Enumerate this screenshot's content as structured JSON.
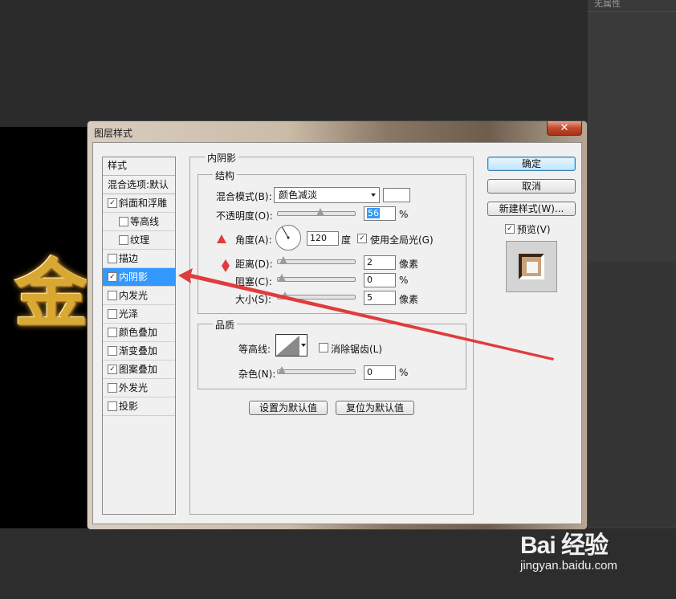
{
  "app": {
    "right_panel_tab": "无属性"
  },
  "canvas": {
    "text": "金"
  },
  "dialog": {
    "title": "图层样式",
    "close_glyph": "✕",
    "styles_header": "样式",
    "blend_options": "混合选项:默认",
    "styles": [
      {
        "label": "斜面和浮雕",
        "checked": true,
        "indent": false
      },
      {
        "label": "等高线",
        "checked": false,
        "indent": true
      },
      {
        "label": "纹理",
        "checked": false,
        "indent": true
      },
      {
        "label": "描边",
        "checked": false,
        "indent": false
      },
      {
        "label": "内阴影",
        "checked": true,
        "indent": false,
        "active": true
      },
      {
        "label": "内发光",
        "checked": false,
        "indent": false
      },
      {
        "label": "光泽",
        "checked": false,
        "indent": false
      },
      {
        "label": "颜色叠加",
        "checked": false,
        "indent": false
      },
      {
        "label": "渐变叠加",
        "checked": false,
        "indent": false
      },
      {
        "label": "图案叠加",
        "checked": true,
        "indent": false
      },
      {
        "label": "外发光",
        "checked": false,
        "indent": false
      },
      {
        "label": "投影",
        "checked": false,
        "indent": false
      }
    ],
    "panel_title": "内阴影",
    "structure": {
      "title": "结构",
      "blend_mode_label": "混合模式(B):",
      "blend_mode_value": "颜色减淡",
      "shadow_color": "#ffffff",
      "opacity_label": "不透明度(O):",
      "opacity_value": "56",
      "opacity_level": 0.56,
      "percent": "%",
      "angle_label": "角度(A):",
      "angle_value": "120",
      "angle_unit": "度",
      "global_light_label": "使用全局光(G)",
      "global_light_checked": true,
      "distance_label": "距离(D):",
      "distance_value": "2",
      "distance_level": 0.02,
      "choke_label": "阻塞(C):",
      "choke_value": "0",
      "choke_level": 0,
      "size_label": "大小(S):",
      "size_value": "5",
      "size_level": 0.05,
      "pixels": "像素"
    },
    "quality": {
      "title": "品质",
      "contour_label": "等高线:",
      "antialias_label": "消除锯齿(L)",
      "antialias_checked": false,
      "noise_label": "杂色(N):",
      "noise_value": "0",
      "noise_level": 0,
      "percent": "%"
    },
    "set_default": "设置为默认值",
    "reset_default": "复位为默认值",
    "ok": "确定",
    "cancel": "取消",
    "new_style": "新建样式(W)...",
    "preview_label": "预览(V)",
    "preview_checked": true
  },
  "watermark": {
    "brand": "Bai 经验",
    "domain": "jingyan.baidu.com"
  },
  "colors": {
    "accent_red": "#e03c3c",
    "selection_blue": "#3399ff"
  }
}
